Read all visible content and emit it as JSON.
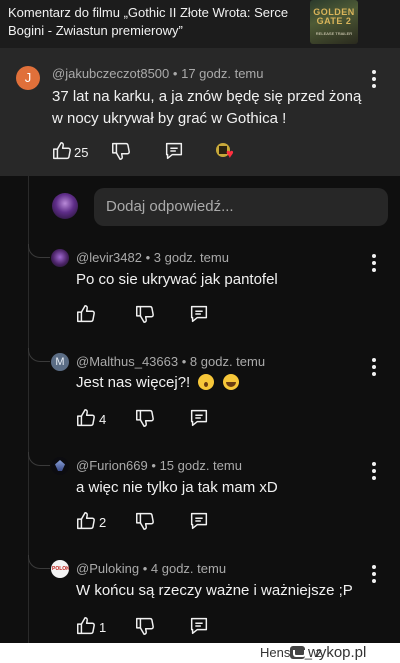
{
  "header": {
    "title": "Komentarz do filmu „Gothic II Złote Wrota: Serce Bogini - Zwiastun premierowy”",
    "thumbnail_title": "GOLDEN GATE 2",
    "thumbnail_subtitle": "RELEASE TRAILER"
  },
  "main_comment": {
    "avatar_letter": "J",
    "username": "@jakubczeczot8500",
    "time": "17 godz. temu",
    "text": "37 lat na karku, a ja znów będę się przed żoną w nocy ukrywał by grać w Gothica !",
    "likes": "25"
  },
  "reply_box": {
    "placeholder": "Dodaj odpowiedź..."
  },
  "replies": [
    {
      "username": "@levir3482",
      "time": "3 godz. temu",
      "text": "Po co sie ukrywać jak pantofel",
      "likes": ""
    },
    {
      "avatar_letter": "M",
      "username": "@Malthus_43663",
      "time": "8 godz. temu",
      "text": "Jest nas więcej?!",
      "likes": "4"
    },
    {
      "username": "@Furion669",
      "time": "15 godz. temu",
      "text": "a więc nie tylko ja tak mam xD",
      "likes": "2"
    },
    {
      "avatar_text": "POLOK",
      "username": "@Puloking",
      "time": "4 godz. temu",
      "text": "W końcu są rzeczy ważne i ważniejsze ;P",
      "likes": "1"
    }
  ],
  "separator": "•",
  "footer": {
    "user": "Henson_ z",
    "brand": "wykop.pl"
  },
  "colors": {
    "background": "#0f0f0f",
    "main_comment_bg": "#282828",
    "avatar_j": "#e0703a",
    "heart": "#ff3040"
  }
}
